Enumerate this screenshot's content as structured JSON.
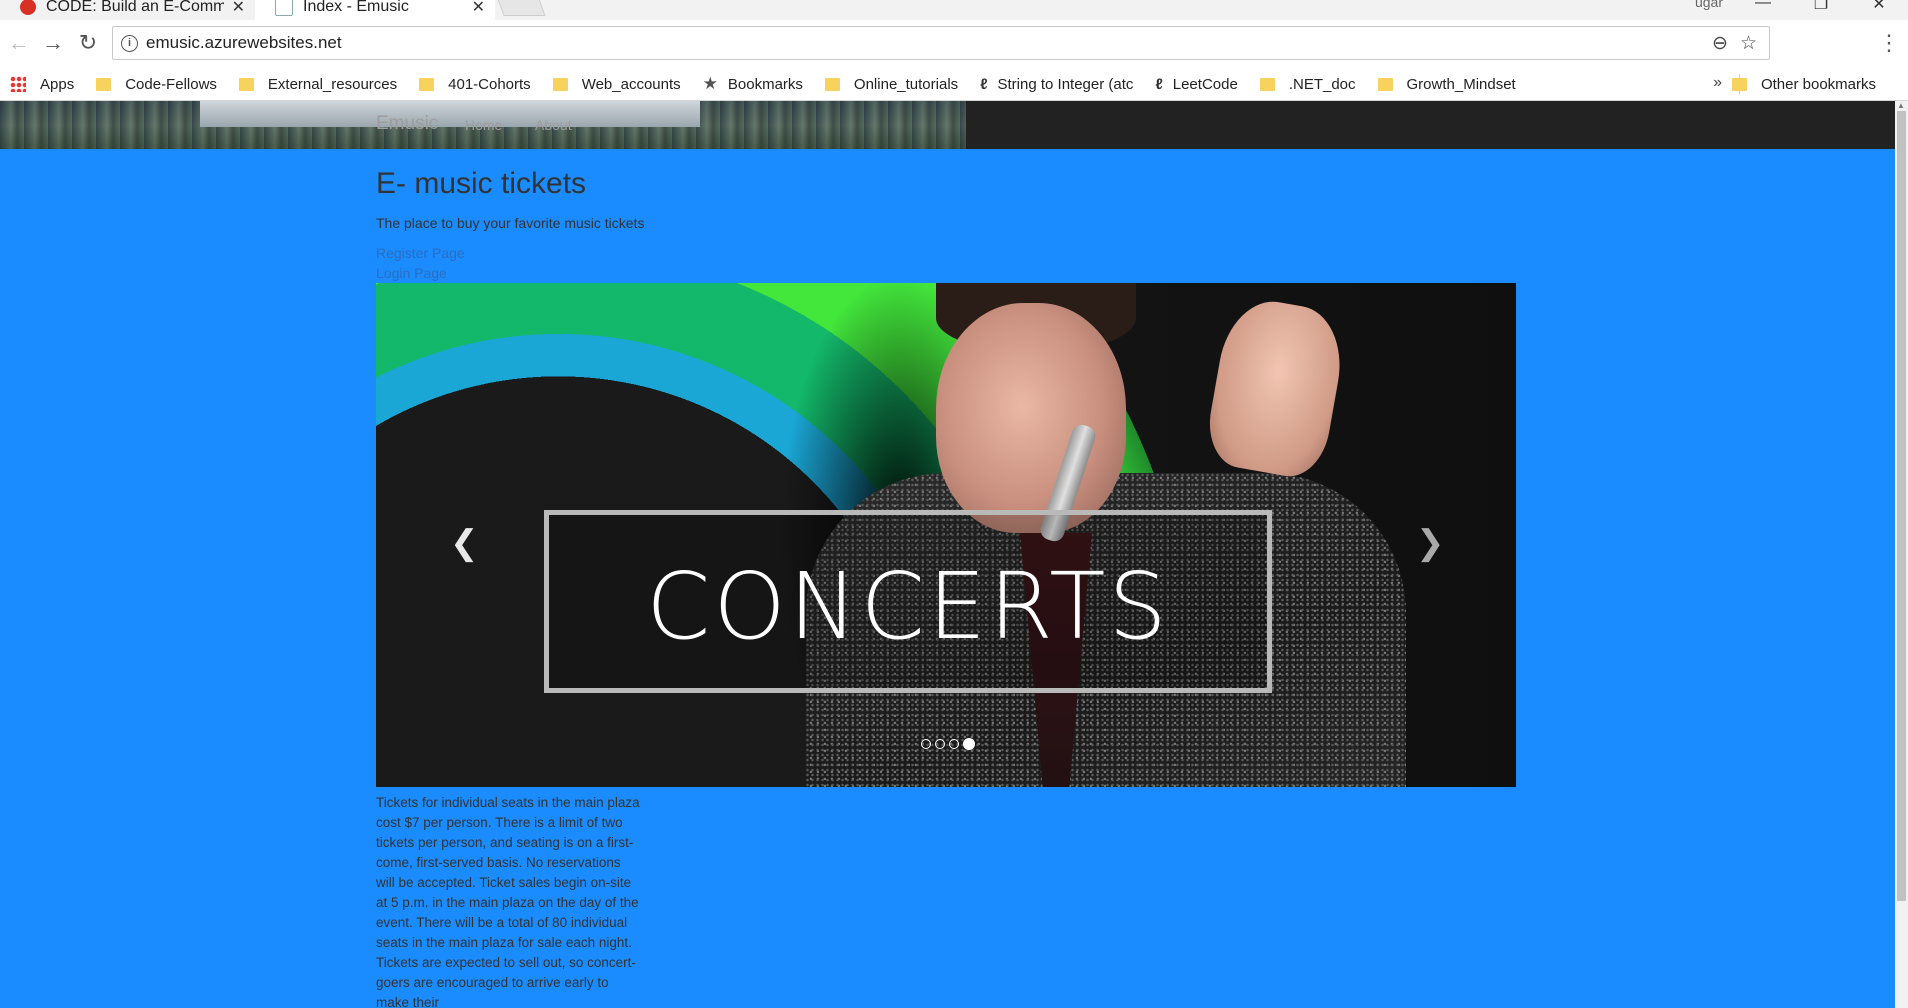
{
  "browser": {
    "tabs": [
      {
        "title": "CODE: Build an E-Comme",
        "active": false
      },
      {
        "title": "Index - Emusic",
        "active": true
      }
    ],
    "profile": "ugar",
    "url": "emusic.azurewebsites.net",
    "bookmarks": [
      {
        "label": "Apps",
        "icon": "apps-grid-icon"
      },
      {
        "label": "Code-Fellows",
        "icon": "folder-icon"
      },
      {
        "label": "External_resources",
        "icon": "folder-icon"
      },
      {
        "label": "401-Cohorts",
        "icon": "folder-icon"
      },
      {
        "label": "Web_accounts",
        "icon": "folder-icon"
      },
      {
        "label": "Bookmarks",
        "icon": "star-icon"
      },
      {
        "label": "Online_tutorials",
        "icon": "folder-icon"
      },
      {
        "label": "String to Integer (atc",
        "icon": "leetcode-icon"
      },
      {
        "label": "LeetCode",
        "icon": "leetcode-icon"
      },
      {
        "label": ".NET_doc",
        "icon": "folder-icon"
      },
      {
        "label": "Growth_Mindset",
        "icon": "folder-icon"
      }
    ],
    "overflow": "»",
    "other_bookmarks": "Other bookmarks"
  },
  "page": {
    "navbar": {
      "brand": "Emusic",
      "links": [
        "Home",
        "About"
      ]
    },
    "title": "E- music tickets",
    "lead": "The place to buy your favorite music tickets",
    "links": {
      "register": "Register Page",
      "login": "Login Page"
    },
    "carousel": {
      "caption": "CONCERTS",
      "slide_count": 4,
      "active_index": 3
    },
    "body_text": "Tickets for individual seats in the main plaza cost $7 per person. There is a limit of two tickets per person, and seating is on a first-come, first-served basis. No reservations will be accepted. Ticket sales begin on-site at 5 p.m. in the main plaza on the day of the event. There will be a total of 80 individual seats in the main plaza for sale each night. Tickets are expected to sell out, so concert-goers are encouraged to arrive early to make their"
  },
  "colors": {
    "page_background": "#1a8cff",
    "navbar_background": "#222222",
    "text": "#333333",
    "link": "#2a6ec0"
  }
}
